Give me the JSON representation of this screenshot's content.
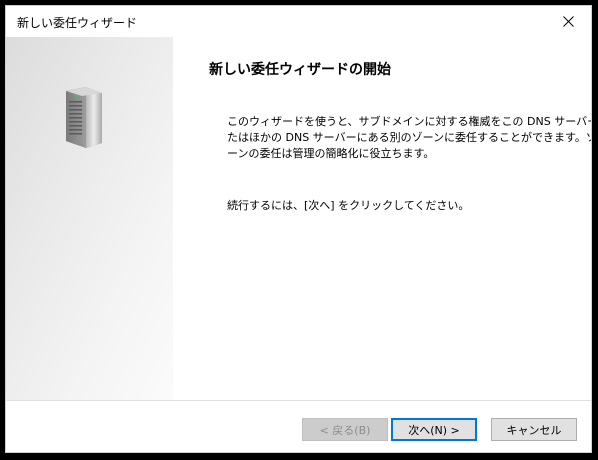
{
  "window": {
    "title": "新しい委任ウィザード"
  },
  "icons": {
    "close": "close-icon",
    "server": "server-icon"
  },
  "content": {
    "heading": "新しい委任ウィザードの開始",
    "description_lines": [
      "このウィザードを使うと、サブドメインに対する権威をこの DNS サーバーま",
      "たはほかの DNS サーバーにある別のゾーンに委任することができます。ゾ",
      "ーンの委任は管理の簡略化に役立ちます。"
    ],
    "instruction": "続行するには、[次へ] をクリックしてください。"
  },
  "buttons": {
    "back": "< 戻る(B)",
    "next": "次へ(N) >",
    "cancel": "キャンセル"
  },
  "colors": {
    "accent": "#0078d7",
    "disabled_text": "#8c8c8c",
    "button_face": "#e1e1e1"
  }
}
